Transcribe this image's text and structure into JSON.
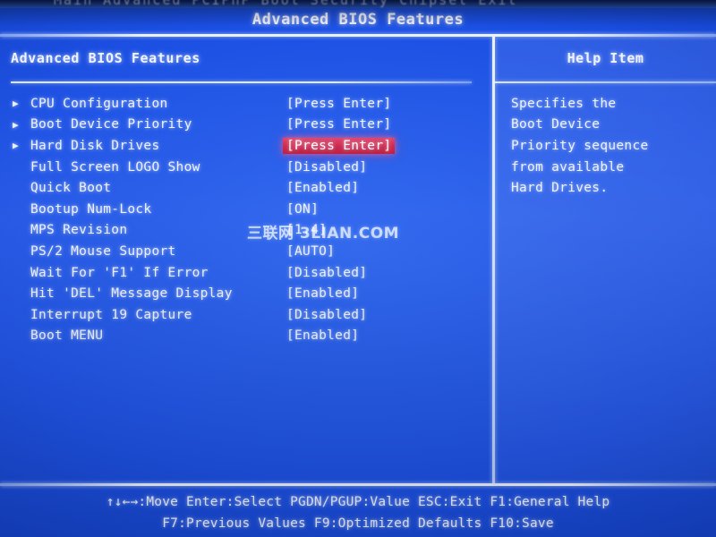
{
  "screen": {
    "background_color": "#1b4fe3",
    "text_color": "#edf2ff",
    "highlight_color": "#cb2147",
    "top_cut_menubar": "Main  Advanced  PCIPnP  Boot  Security  Chipset  Exit"
  },
  "title": "Advanced BIOS Features",
  "left_panel": {
    "section_title": "Advanced BIOS Features",
    "arrow_glyph": "▶",
    "options": [
      {
        "arrow": "▶",
        "label": "CPU Configuration",
        "value": "[Press Enter]",
        "selected": false
      },
      {
        "arrow": "▶",
        "label": "Boot Device Priority",
        "value": "[Press Enter]",
        "selected": false
      },
      {
        "arrow": "▶",
        "label": "Hard Disk Drives",
        "value": "[Press Enter]",
        "selected": true
      },
      {
        "arrow": "",
        "label": "Full Screen LOGO Show",
        "value": "[Disabled]",
        "selected": false
      },
      {
        "arrow": "",
        "label": "Quick Boot",
        "value": "[Enabled]",
        "selected": false
      },
      {
        "arrow": "",
        "label": "Bootup Num-Lock",
        "value": "[ON]",
        "selected": false
      },
      {
        "arrow": "",
        "label": "MPS Revision",
        "value": "[1.4]",
        "selected": false
      },
      {
        "arrow": "",
        "label": "PS/2 Mouse Support",
        "value": "[AUTO]",
        "selected": false
      },
      {
        "arrow": "",
        "label": "Wait For 'F1' If Error",
        "value": "[Disabled]",
        "selected": false
      },
      {
        "arrow": "",
        "label": "Hit 'DEL' Message Display",
        "value": "[Enabled]",
        "selected": false
      },
      {
        "arrow": "",
        "label": "Interrupt 19 Capture",
        "value": "[Disabled]",
        "selected": false
      },
      {
        "arrow": "",
        "label": "Boot MENU",
        "value": "[Enabled]",
        "selected": false
      }
    ]
  },
  "help_panel": {
    "title": "Help Item",
    "lines": [
      "Specifies the",
      "Boot Device",
      "Priority sequence",
      "from available",
      "Hard Drives."
    ]
  },
  "footer": {
    "line1": "↑↓←→:Move   Enter:Select   PGDN/PGUP:Value    ESC:Exit   F1:General Help",
    "line2": "F7:Previous Values  F9:Optimized Defaults  F10:Save"
  },
  "watermark": {
    "text": "三联网 3LIAN.COM"
  }
}
